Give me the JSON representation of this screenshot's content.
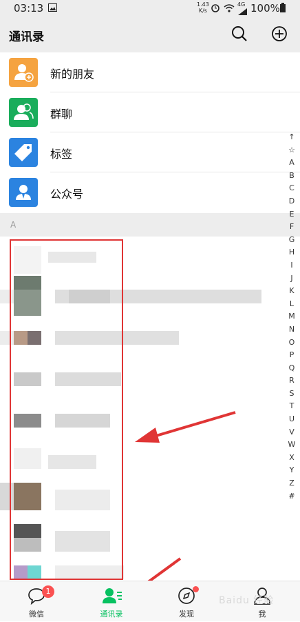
{
  "status_bar": {
    "time": "03:13",
    "speed_value": "1.43",
    "speed_unit": "K/s",
    "network": "4G",
    "battery": "100%"
  },
  "header": {
    "title": "通讯录",
    "search_icon": "search-icon",
    "add_icon": "plus-circle-icon"
  },
  "fixed_items": [
    {
      "label": "新的朋友",
      "icon": "add-friend-icon",
      "color": "#f5a340"
    },
    {
      "label": "群聊",
      "icon": "group-chat-icon",
      "color": "#1aad5b"
    },
    {
      "label": "标签",
      "icon": "tag-icon",
      "color": "#2b83e0"
    },
    {
      "label": "公众号",
      "icon": "official-account-icon",
      "color": "#2b83e0"
    }
  ],
  "section_letter": "A",
  "index_letters": [
    "↑",
    "☆",
    "A",
    "B",
    "C",
    "D",
    "E",
    "F",
    "G",
    "H",
    "I",
    "J",
    "K",
    "L",
    "M",
    "N",
    "O",
    "P",
    "Q",
    "R",
    "S",
    "T",
    "U",
    "V",
    "W",
    "X",
    "Y",
    "Z",
    "#"
  ],
  "tabs": [
    {
      "label": "微信",
      "icon": "chat-bubble-icon",
      "badge": "1",
      "active": false
    },
    {
      "label": "通讯录",
      "icon": "contacts-icon",
      "badge": "",
      "active": true
    },
    {
      "label": "发现",
      "icon": "compass-icon",
      "badge": "",
      "active": false
    },
    {
      "label": "我",
      "icon": "person-icon",
      "badge": "",
      "active": false
    }
  ],
  "colors": {
    "accent": "#07c160",
    "annotation": "#e03535",
    "badge": "#fa5151"
  },
  "watermark": "Baidu 经验"
}
